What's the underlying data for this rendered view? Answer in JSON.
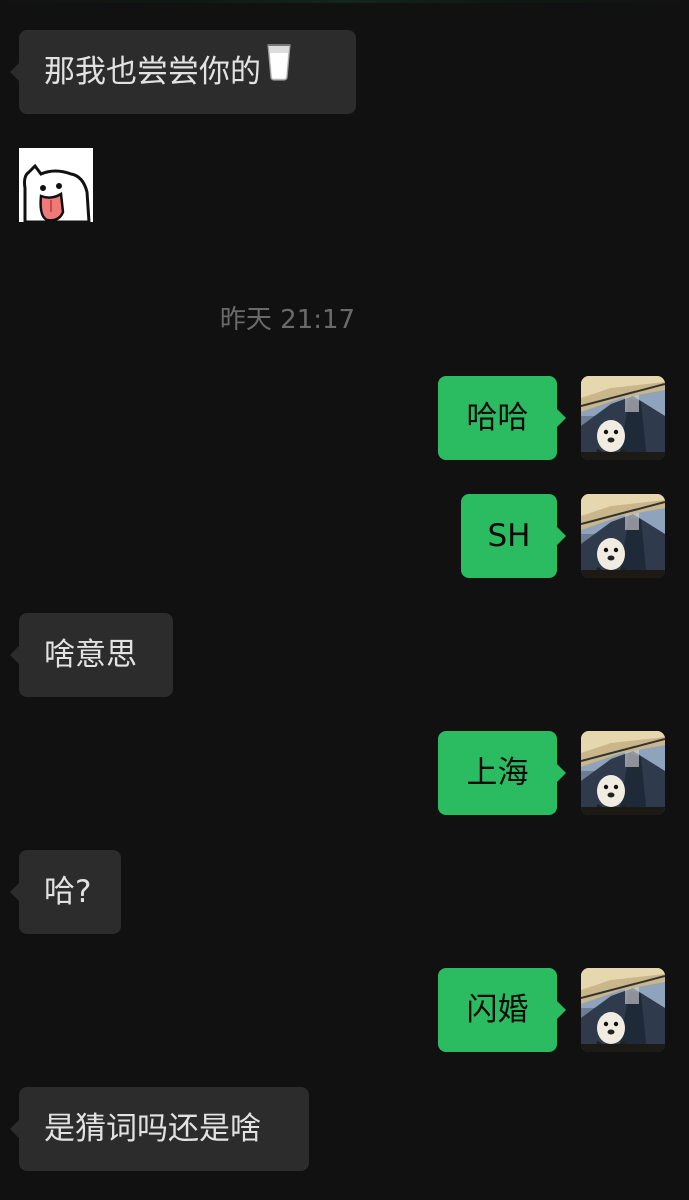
{
  "chat": {
    "timestamp": "昨天 21:17",
    "messages": [
      {
        "side": "in",
        "text": "那我也尝尝你的",
        "emoji": "milk-glass"
      },
      {
        "side": "in",
        "type": "sticker",
        "sticker": "tongue-out-cat"
      },
      {
        "side": "out",
        "text": "哈哈"
      },
      {
        "side": "out",
        "text": "SH"
      },
      {
        "side": "in",
        "text": "啥意思"
      },
      {
        "side": "out",
        "text": "上海"
      },
      {
        "side": "in",
        "text": "哈?"
      },
      {
        "side": "out",
        "text": "闪婚"
      },
      {
        "side": "in",
        "text": "是猜词吗还是啥"
      }
    ]
  },
  "colors": {
    "background": "#111111",
    "incoming_bubble": "#2c2c2c",
    "outgoing_bubble": "#2bbb61",
    "timestamp_text": "#6a6a6a"
  },
  "icons": {
    "avatar": "avatar-dog-mountain",
    "sticker": "tongue-out-cat-sticker"
  }
}
